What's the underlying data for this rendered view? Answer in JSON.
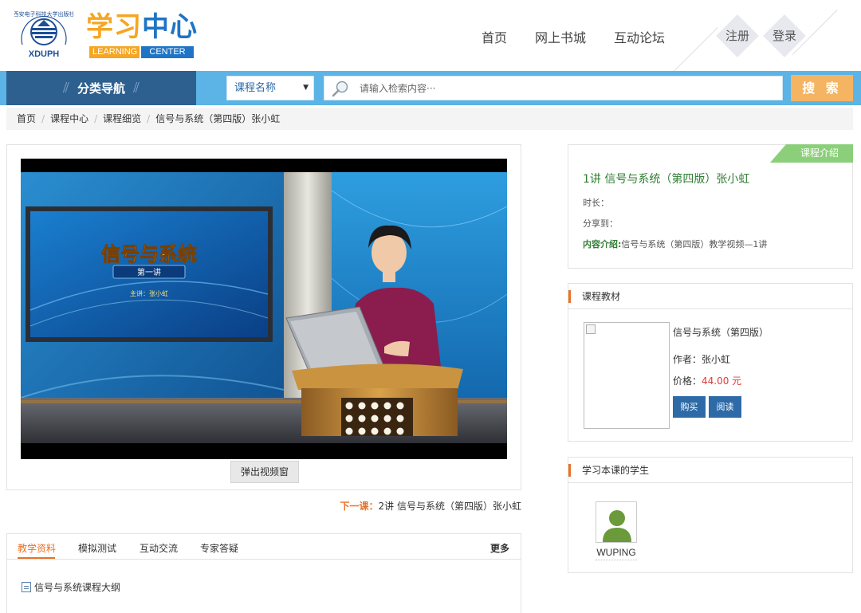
{
  "header": {
    "logo_seal_text": "西安电子科技大学出版社",
    "logo_abbr": "XDUPH",
    "logo_cn_part1": "学习",
    "logo_cn_part2": "中心",
    "logo_en_part1": "LEARNING",
    "logo_en_part2": "CENTER",
    "nav": [
      "首页",
      "网上书城",
      "互动论坛"
    ],
    "register_label": "注册",
    "login_label": "登录"
  },
  "searchbar": {
    "category_nav_label": "分类导航",
    "select_value": "课程名称",
    "search_placeholder": "请输入检索内容···",
    "search_button_label": "搜 索"
  },
  "breadcrumb": [
    "首页",
    "课程中心",
    "课程细览",
    "信号与系统（第四版）张小虹"
  ],
  "video": {
    "slide_title": "信号与系统",
    "slide_lecture": "第一讲",
    "slide_speaker": "主讲：张小虹",
    "popup_button_label": "弹出视频窗"
  },
  "next_lesson": {
    "label": "下一课：",
    "title": "2讲 信号与系统（第四版）张小虹"
  },
  "tabs": {
    "items": [
      "教学资料",
      "模拟测试",
      "互动交流",
      "专家答疑"
    ],
    "active": "教学资料",
    "more_label": "更多",
    "doc_item": "信号与系统课程大纲"
  },
  "intro": {
    "flag_label": "课程介绍",
    "title": "1讲 信号与系统（第四版）张小虹",
    "duration_label": "时长：",
    "share_label": "分享到：",
    "content_label": "内容介绍:",
    "content_text": "信号与系统（第四版）教学视频—1讲"
  },
  "textbook": {
    "heading": "课程教材",
    "title": "信号与系统（第四版）",
    "author": "作者：张小虹",
    "price_label": "价格：",
    "price_value": "44.00 元",
    "buy_label": "购买",
    "read_label": "阅读"
  },
  "students": {
    "heading": "学习本课的学生",
    "names": [
      "WUPING"
    ]
  },
  "colors": {
    "brand_blue": "#2d5f8f",
    "bar_blue": "#5bb4e5",
    "accent_orange": "#e8722a",
    "search_button": "#f4b462",
    "intro_green": "#8ccf7b",
    "price_red": "#e03a3a"
  }
}
